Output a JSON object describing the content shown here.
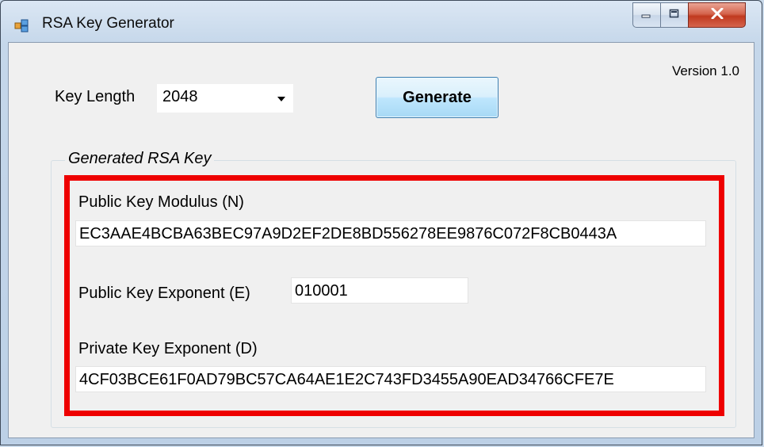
{
  "window": {
    "title": "RSA Key Generator",
    "icon": "app-window-icon",
    "controls": [
      "minimize-icon",
      "maximize-icon",
      "close-icon"
    ]
  },
  "header": {
    "version": "Version 1.0"
  },
  "key_length": {
    "label": "Key Length",
    "selected": "2048"
  },
  "generate_button": {
    "label": "Generate"
  },
  "group": {
    "title": "Generated RSA Key",
    "modulus_label": "Public Key Modulus (N)",
    "modulus_value": "EC3AAE4BCBA63BEC97A9D2EF2DE8BD556278EE9876C072F8CB0443A",
    "exponent_label": "Public Key Exponent (E)",
    "exponent_value": "010001",
    "private_label": "Private Key Exponent (D)",
    "private_value": "4CF03BCE61F0AD79BC57CA64AE1E2C743FD3455A90EAD34766CFE7E",
    "highlight_color": "#ee0000"
  }
}
